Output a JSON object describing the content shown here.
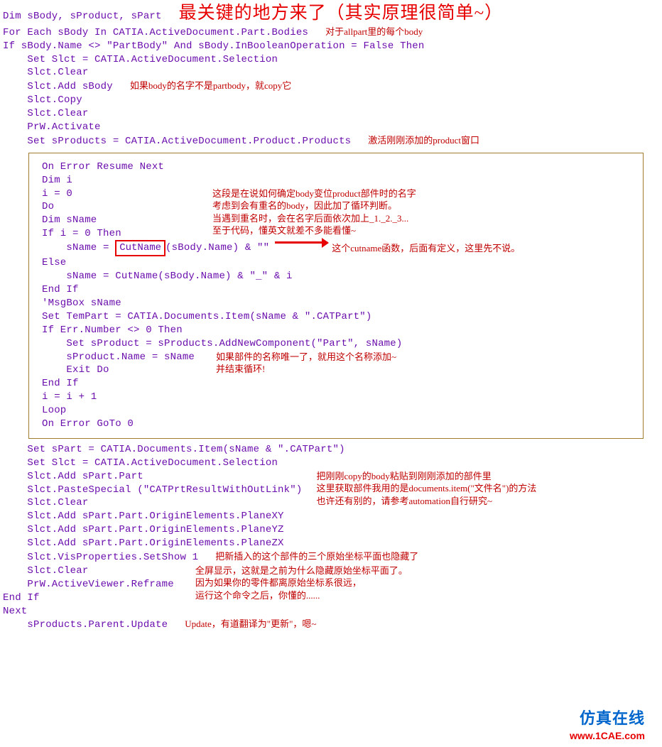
{
  "title_note": "最关键的地方来了（其实原理很简单~）",
  "line1": "Dim sBody, sProduct, sPart",
  "line2": "",
  "line3": "For Each sBody In CATIA.ActiveDocument.Part.Bodies",
  "note_for_each": "对于allpart里的每个body",
  "line4": "If sBody.Name <> \"PartBody\" And sBody.InBooleanOperation = False Then",
  "line5": "    Set Slct = CATIA.ActiveDocument.Selection",
  "line6": "    Slct.Clear",
  "line7": "    Slct.Add sBody",
  "note_copy": "如果body的名字不是partbody，就copy它",
  "line8": "    Slct.Copy",
  "line9": "    Slct.Clear",
  "line10": "    PrW.Activate",
  "line11": "",
  "line12": "    Set sProducts = CATIA.ActiveDocument.Product.Products",
  "note_activate": "激活刚刚添加的product窗口",
  "box": {
    "b1": "On Error Resume Next",
    "b2": "Dim i",
    "b3": "i = 0",
    "note_block1": "这段是在说如何确定body变位product部件时的名字",
    "note_block2": "考虑到会有重名的body，因此加了循环判断。",
    "note_block3": "当遇到重名时，会在名字后面依次加上_1._2._3...",
    "note_block4": "至于代码，懂英文就差不多能看懂~",
    "b4": "Do",
    "b5": "Dim sName",
    "b6": "If i = 0 Then",
    "b7a": "    sName = ",
    "cutname_label": "CutName",
    "b7b": "(sBody.Name) & \"\"",
    "note_cutname": "这个cutname函数，后面有定义，这里先不说。",
    "b8": "Else",
    "b9": "    sName = CutName(sBody.Name) & \"_\" & i",
    "b10": "End If",
    "b11": "'MsgBox sName",
    "b12": "Set TemPart = CATIA.Documents.Item(sName & \".CATPart\")",
    "b13": "",
    "b14": "If Err.Number <> 0 Then",
    "b15": "    Set sProduct = sProducts.AddNewComponent(\"Part\", sName)",
    "b16": "    sProduct.Name = sName",
    "note_unique1": "如果部件的名称唯一了，就用这个名称添加~",
    "note_unique2": "并结束循环!",
    "b17": "    Exit Do",
    "b18": "End If",
    "b19": "i = i + 1",
    "b20": "Loop",
    "b21": "On Error GoTo 0"
  },
  "after": {
    "a1": "    Set sPart = CATIA.Documents.Item(sName & \".CATPart\")",
    "a2": "    Set Slct = CATIA.ActiveDocument.Selection",
    "a3": "    Slct.Add sPart.Part",
    "note_paste1": "把刚刚copy的body粘贴到刚刚添加的部件里",
    "note_paste2": "这里获取部件我用的是documents.item(\"文件名\")的方法",
    "note_paste3": "也许还有别的，请参考automation自行研究~",
    "a4": "    Slct.PasteSpecial (\"CATPrtResultWithOutLink\")",
    "a5": "    Slct.Clear",
    "a6": "    Slct.Add sPart.Part.OriginElements.PlaneXY",
    "a7": "    Slct.Add sPart.Part.OriginElements.PlaneYZ",
    "a8": "    Slct.Add sPart.Part.OriginElements.PlaneZX",
    "a9": "    Slct.VisProperties.SetShow 1",
    "note_hide": "把新插入的这个部件的三个原始坐标平面也隐藏了",
    "a10": "    Slct.Clear",
    "note_reframe1": "全屏显示，这就是之前为什么隐藏原始坐标平面了。",
    "note_reframe2": "因为如果你的零件都离原始坐标系很远，",
    "note_reframe3": "运行这个命令之后，你懂的......",
    "a11": "    PrW.ActiveViewer.Reframe",
    "a12": "End If",
    "a13": "Next",
    "a14": "    sProducts.Parent.Update",
    "note_update": "Update，有道翻译为\"更新\"，嗯~"
  },
  "logo": {
    "top": "仿真在线",
    "bottom": "www.1CAE.com"
  }
}
